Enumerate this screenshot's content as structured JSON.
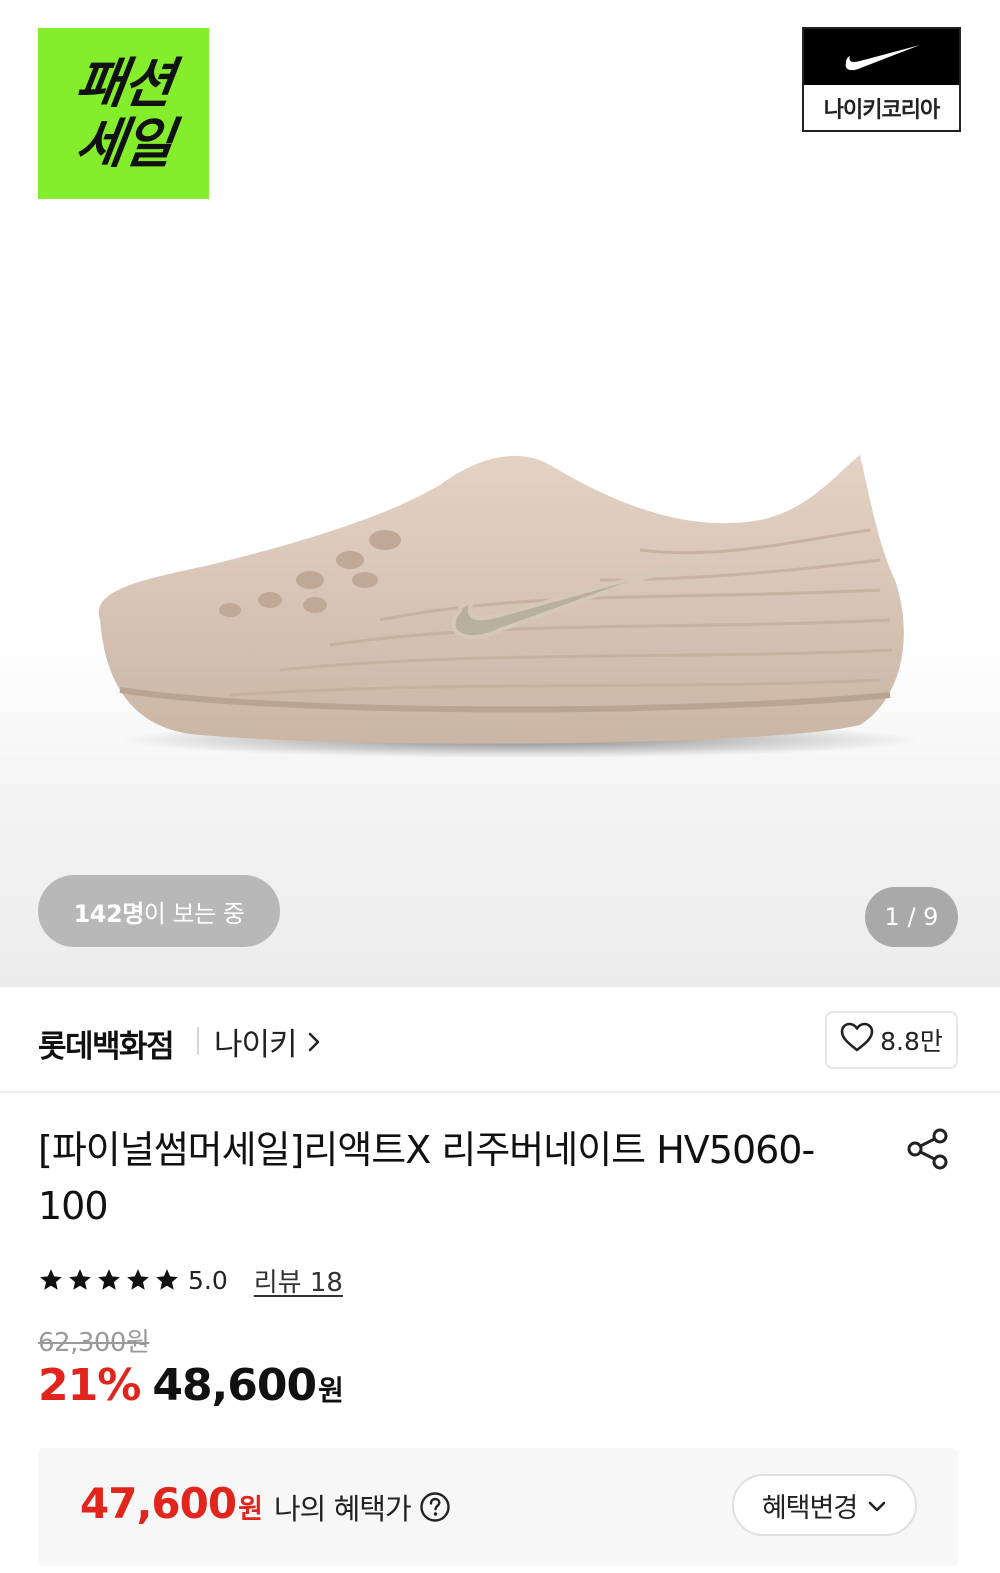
{
  "hero": {
    "sale_badge_line1": "패션",
    "sale_badge_line2": "세일",
    "brand_badge_text": "나이키코리아",
    "viewers_count": "142명",
    "viewers_suffix": "이 보는 중",
    "page_indicator": "1 / 9",
    "colors": {
      "badge_green": "#84ee2c",
      "shoe": "#d9c6b5"
    }
  },
  "store": {
    "name": "롯데백화점",
    "brand": "나이키",
    "like_count": "8.8만"
  },
  "product": {
    "title": "[파이널썸머세일]리액트X 리주버네이트 HV5060-100",
    "rating": {
      "stars": 5,
      "score": "5.0",
      "review_label": "리뷰 18"
    },
    "original_price": "62,300원",
    "discount_rate": "21%",
    "sale_price": "48,600",
    "currency": "원"
  },
  "benefit": {
    "price": "47,600",
    "currency": "원",
    "label": "나의 혜택가",
    "change_button": "혜택변경"
  },
  "colors": {
    "accent_red": "#e1241c",
    "text": "#111111"
  }
}
